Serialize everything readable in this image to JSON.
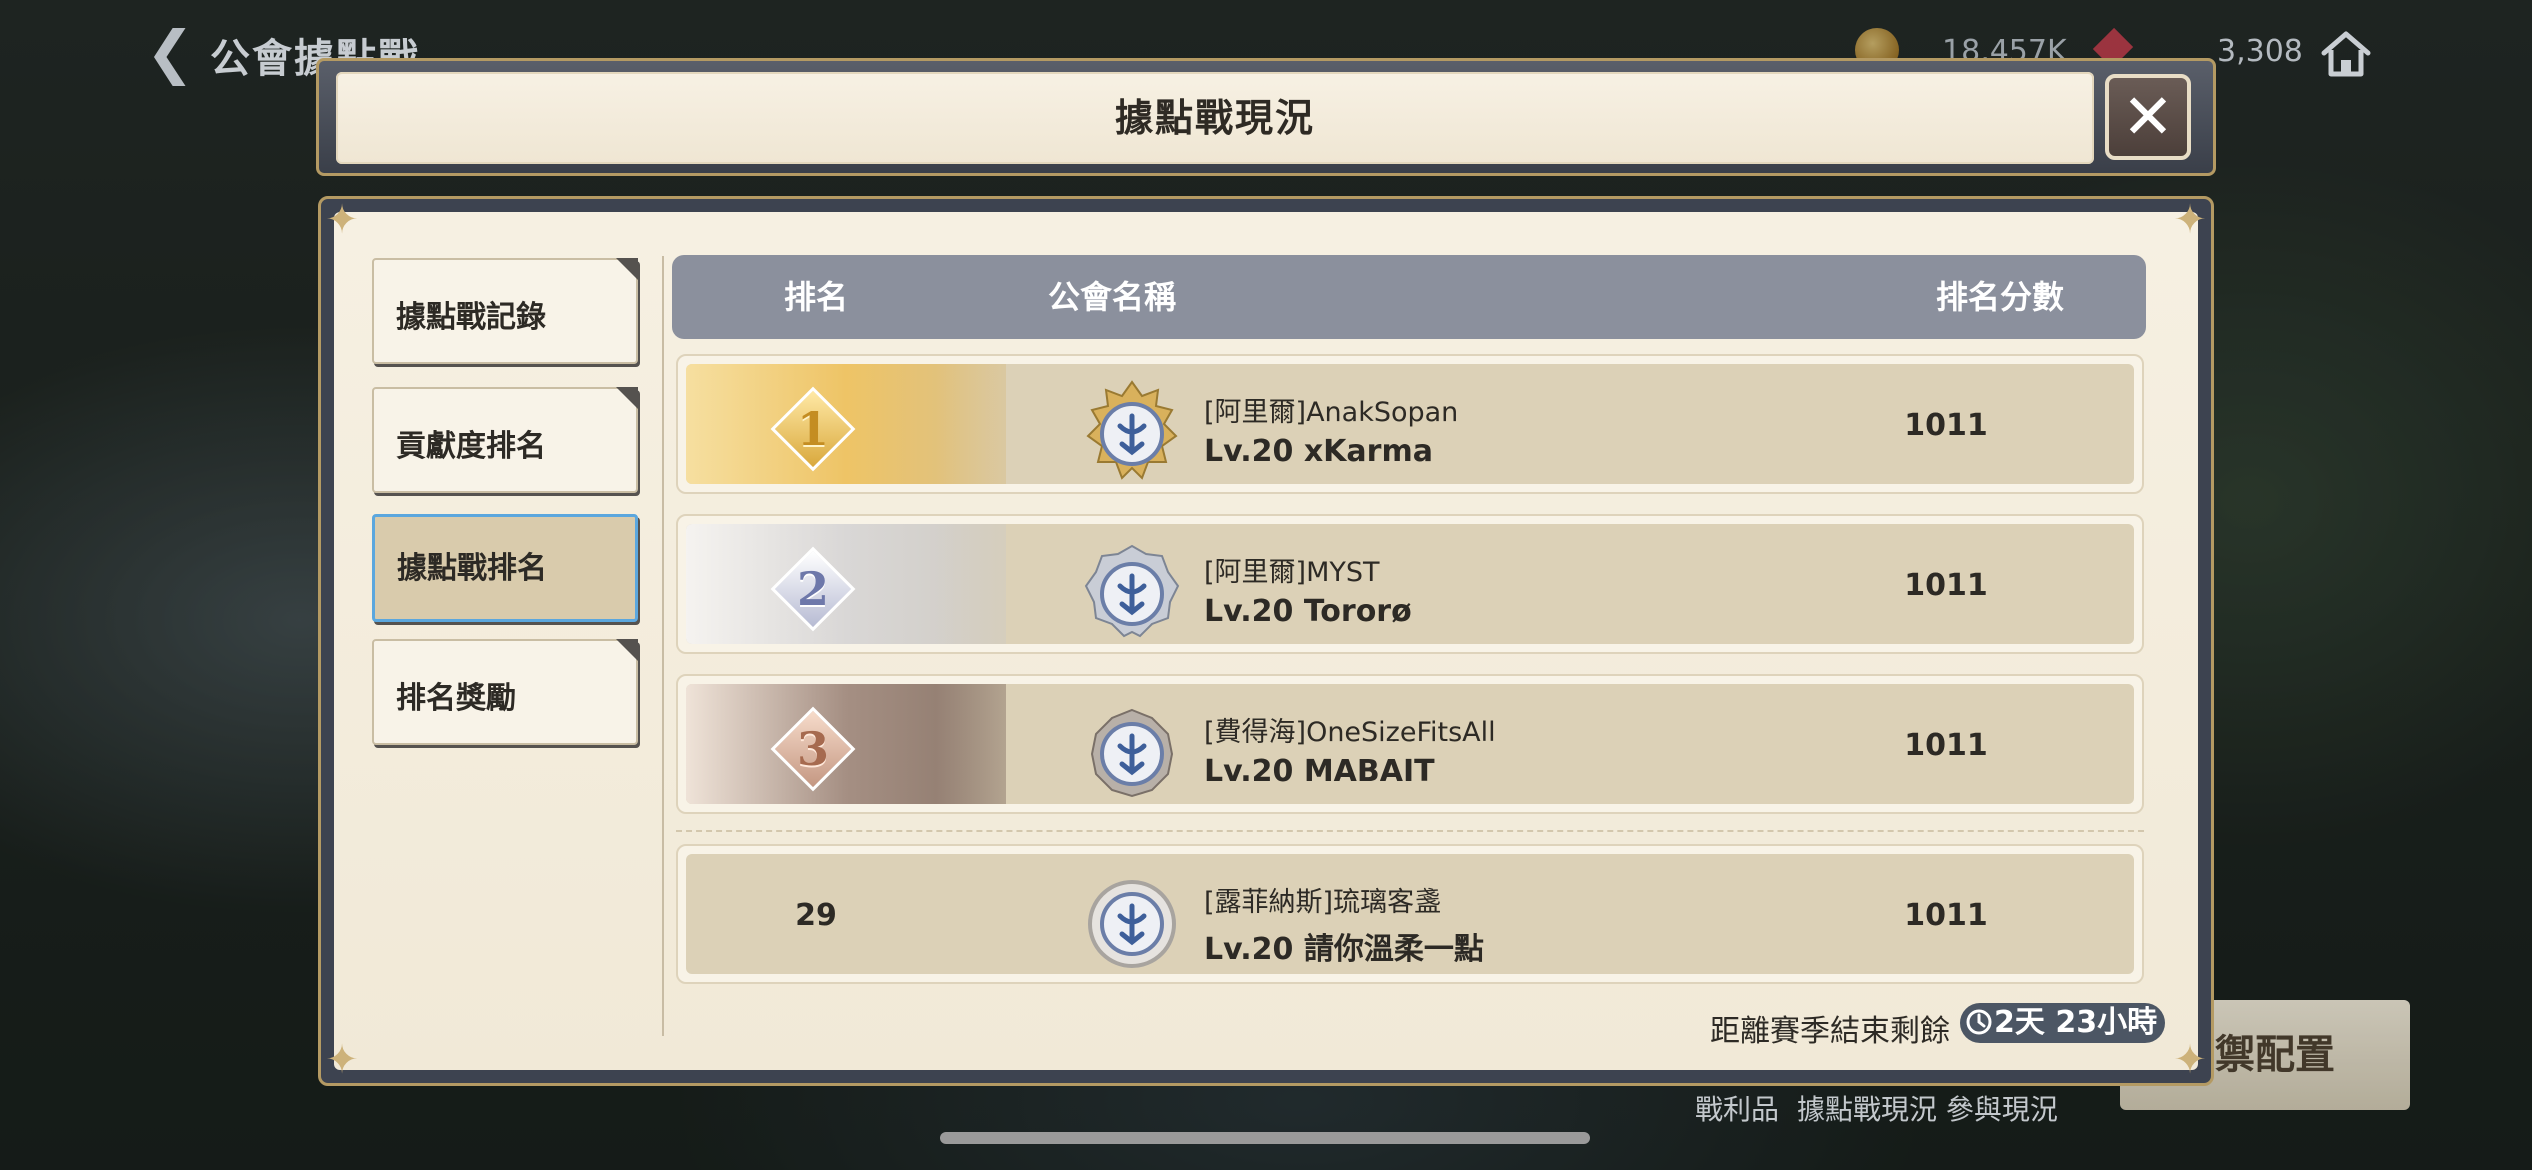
{
  "header": {
    "title": "公會據點戰",
    "currency_gold": "18,457K",
    "currency_gems": "3,308"
  },
  "modal": {
    "title": "據點戰現況",
    "tabs": [
      {
        "label": "據點戰記錄",
        "active": false
      },
      {
        "label": "貢獻度排名",
        "active": false
      },
      {
        "label": "據點戰排名",
        "active": true
      },
      {
        "label": "排名獎勵",
        "active": false
      }
    ],
    "table": {
      "columns": [
        "排名",
        "公會名稱",
        "排名分數"
      ],
      "rows": [
        {
          "rank": "1",
          "rank_style": "gold",
          "guild": "[阿里爾]AnakSopan",
          "leader": "Lv.20 xKarma",
          "score": "1011"
        },
        {
          "rank": "2",
          "rank_style": "silver",
          "guild": "[阿里爾]MYST",
          "leader": "Lv.20 Tororø",
          "score": "1011"
        },
        {
          "rank": "3",
          "rank_style": "bronze",
          "guild": "[費得海]OneSizeFitsAll",
          "leader": "Lv.20 MABAIT",
          "score": "1011"
        }
      ],
      "my_row": {
        "rank": "29",
        "guild": "[露菲納斯]琉璃客盞",
        "leader": "Lv.20 請你溫柔一點",
        "score": "1011"
      }
    },
    "season_label": "距離賽季結束剩餘",
    "season_remaining": "2天 23小時"
  },
  "background": {
    "deploy_button": "禦配置",
    "bottom_links": [
      "戰利品",
      "據點戰現況 參與現況"
    ]
  },
  "colors": {
    "header_bar": "#8b909d",
    "active_tab_border": "#5ba7de",
    "gold": "#eec466",
    "silver": "#d9d7d6",
    "bronze": "#a58f83"
  }
}
